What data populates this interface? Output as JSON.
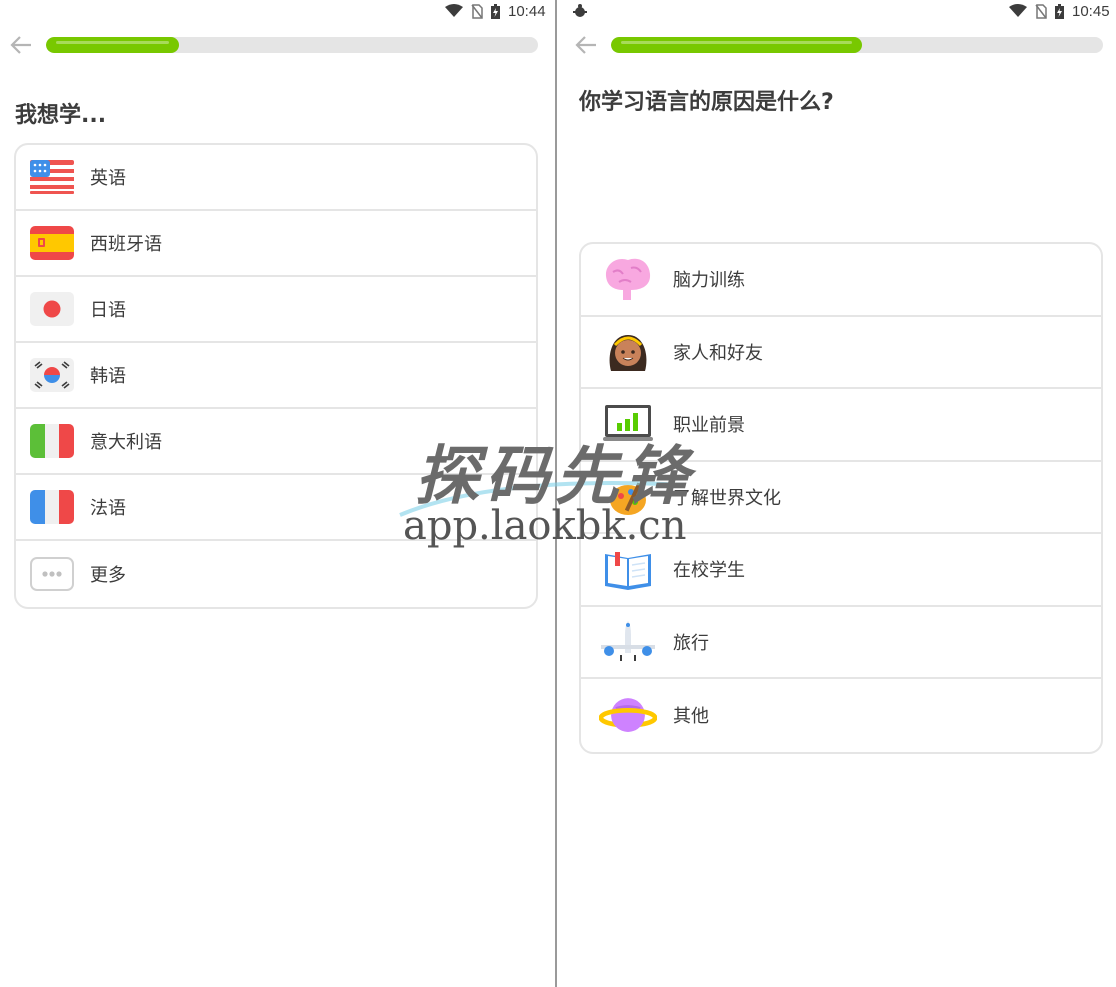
{
  "left": {
    "status": {
      "time": "10:44"
    },
    "progress": 0.27,
    "title": "我想学...",
    "items": [
      {
        "label": "英语",
        "icon": "us-flag-icon"
      },
      {
        "label": "西班牙语",
        "icon": "spain-flag-icon"
      },
      {
        "label": "日语",
        "icon": "japan-flag-icon"
      },
      {
        "label": "韩语",
        "icon": "korea-flag-icon"
      },
      {
        "label": "意大利语",
        "icon": "italy-flag-icon"
      },
      {
        "label": "法语",
        "icon": "france-flag-icon"
      },
      {
        "label": "更多",
        "icon": "more-icon"
      }
    ]
  },
  "right": {
    "status": {
      "time": "10:45"
    },
    "progress": 0.51,
    "title": "你学习语言的原因是什么?",
    "items": [
      {
        "label": "脑力训练",
        "icon": "brain-icon"
      },
      {
        "label": "家人和好友",
        "icon": "person-icon"
      },
      {
        "label": "职业前景",
        "icon": "career-chart-icon"
      },
      {
        "label": "了解世界文化",
        "icon": "culture-icon"
      },
      {
        "label": "在校学生",
        "icon": "book-icon"
      },
      {
        "label": "旅行",
        "icon": "airplane-icon"
      },
      {
        "label": "其他",
        "icon": "planet-icon"
      }
    ]
  },
  "watermark": {
    "title": "探码先锋",
    "url": "app.laokbk.cn"
  },
  "colors": {
    "progress": "#78c800",
    "track": "#e5e5e5",
    "border": "#e5e5e5",
    "text": "#3c3c3c"
  }
}
